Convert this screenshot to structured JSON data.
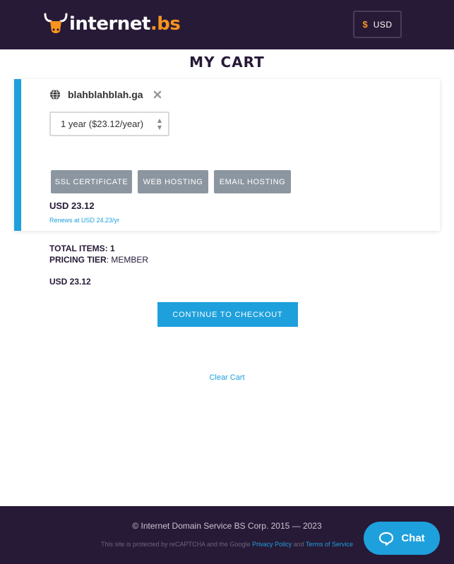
{
  "header": {
    "logo_text": "internet",
    "logo_tld": ".bs",
    "currency_symbol": "$",
    "currency_code": "USD"
  },
  "page_title": "MY CART",
  "cart_item": {
    "domain": "blahblahblah.ga",
    "period": "1 year ($23.12/year)",
    "addons": [
      "SSL CERTIFICATE",
      "WEB HOSTING",
      "EMAIL HOSTING"
    ],
    "price": "USD 23.12",
    "renews": "Renews at USD 24.23/yr"
  },
  "summary": {
    "total_items_label": "TOTAL ITEMS:",
    "total_items_value": "1",
    "pricing_tier_label": "PRICING TIER",
    "pricing_tier_value": ": MEMBER",
    "total": "USD 23.12"
  },
  "checkout_label": "CONTINUE TO CHECKOUT",
  "clear_cart_label": "Clear Cart",
  "footer": {
    "copyright": "© Internet Domain Service BS Corp. 2015 — 2023",
    "recaptcha_prefix": "This site is protected by reCAPTCHA and the Google",
    "privacy_label": "Privacy Policy",
    "and_label": "and",
    "terms_label": "Terms of Service"
  },
  "chat_label": "Chat",
  "colors": {
    "header_bg": "#271a37",
    "accent_blue": "#1ea0dc",
    "accent_orange": "#f7941d",
    "addon_grey": "#8c96a0"
  },
  "icons": [
    "bull-logo-icon",
    "globe-icon",
    "remove-icon",
    "select-arrows-icon",
    "chat-bubble-icon"
  ]
}
